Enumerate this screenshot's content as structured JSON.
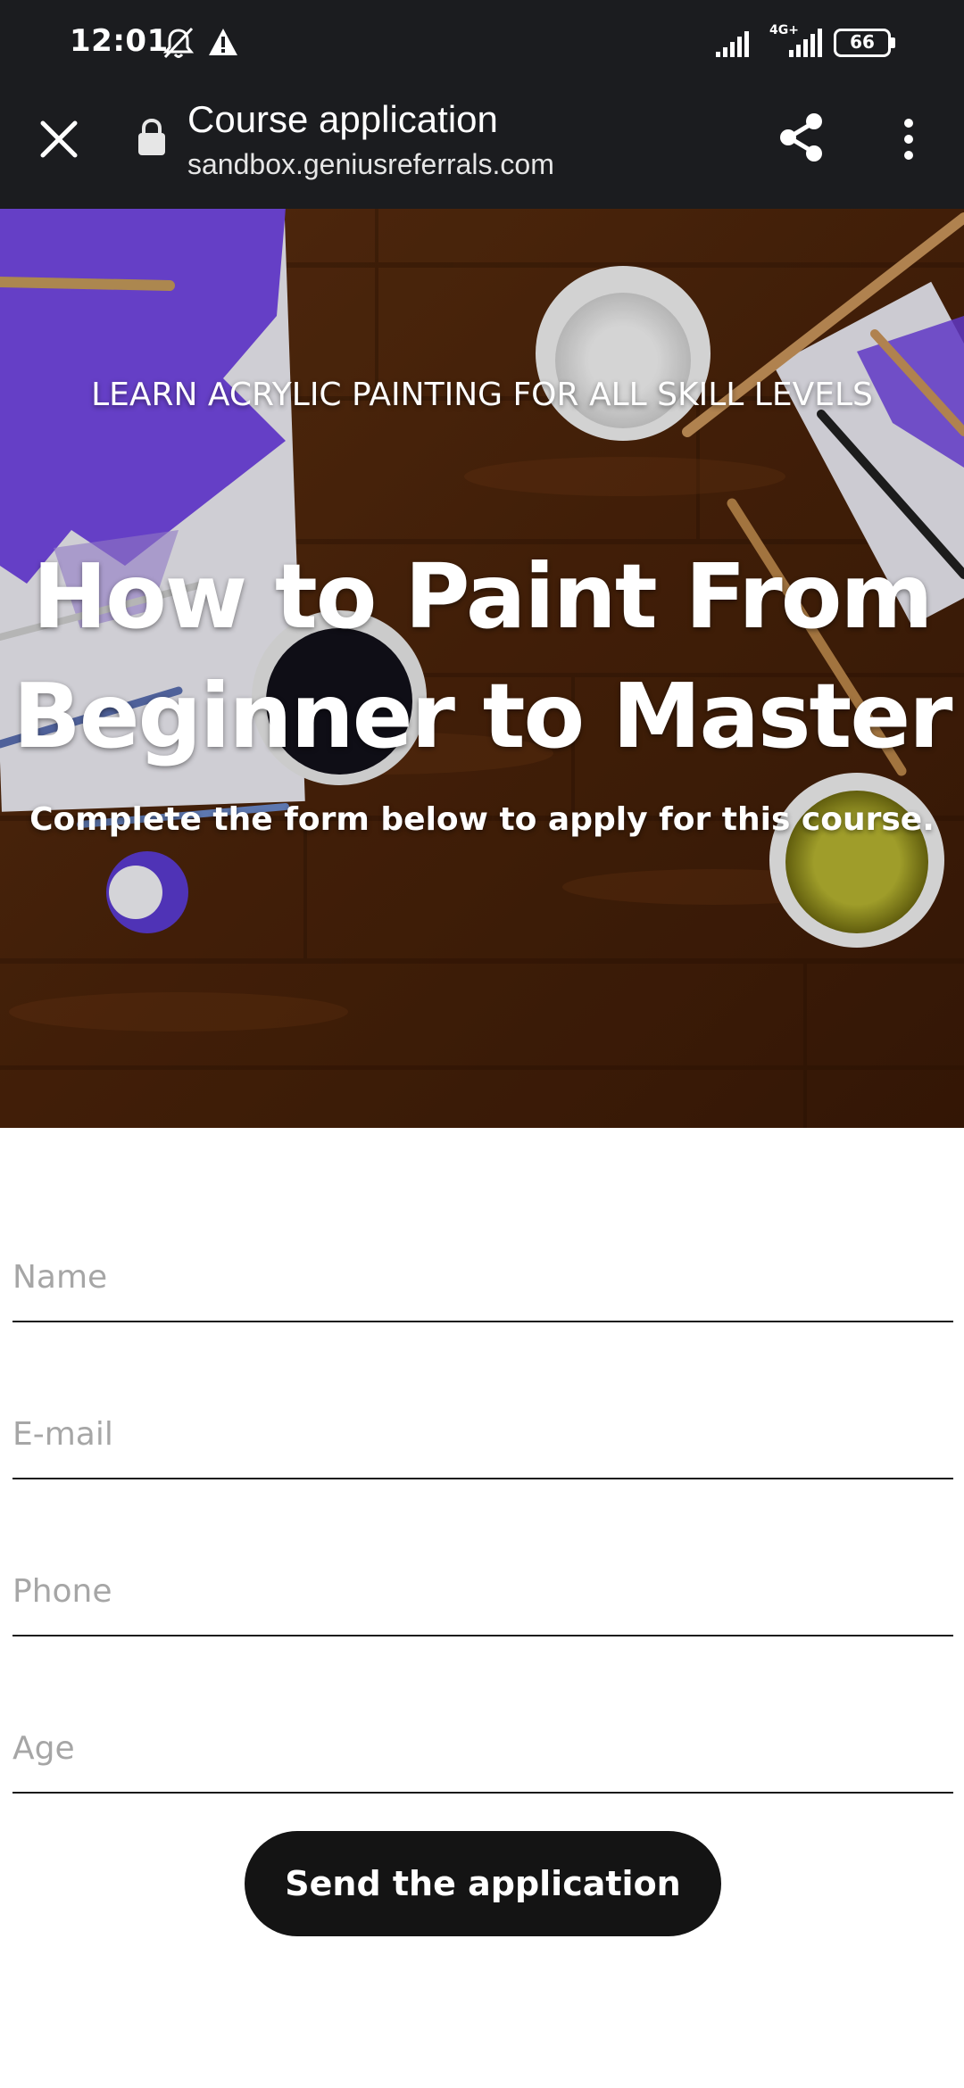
{
  "status_bar": {
    "time": "12:01",
    "battery": "66",
    "network_label": "4G+",
    "icons": [
      "alarm-off-icon",
      "warning-icon",
      "signal-icon",
      "signal-4g-icon",
      "battery-icon"
    ]
  },
  "browser": {
    "title": "Course application",
    "url": "sandbox.geniusreferrals.com",
    "icons": [
      "close-icon",
      "lock-icon",
      "share-icon",
      "more-vert-icon"
    ]
  },
  "hero": {
    "kicker": "LEARN ACRYLIC PAINTING FOR ALL SKILL LEVELS",
    "title_line1": "How to Paint From",
    "title_line2": "Beginner to Master",
    "subtitle": "Complete the form below to apply for this course."
  },
  "form": {
    "name_placeholder": "Name",
    "email_placeholder": "E-mail",
    "phone_placeholder": "Phone",
    "age_placeholder": "Age",
    "submit_label": "Send the application"
  },
  "colors": {
    "bar_bg": "#1b1c1f",
    "button_bg": "#141414",
    "placeholder": "#a6a6a6",
    "wood": "#5a2e10",
    "paint_purple": "#6d3fe0"
  }
}
